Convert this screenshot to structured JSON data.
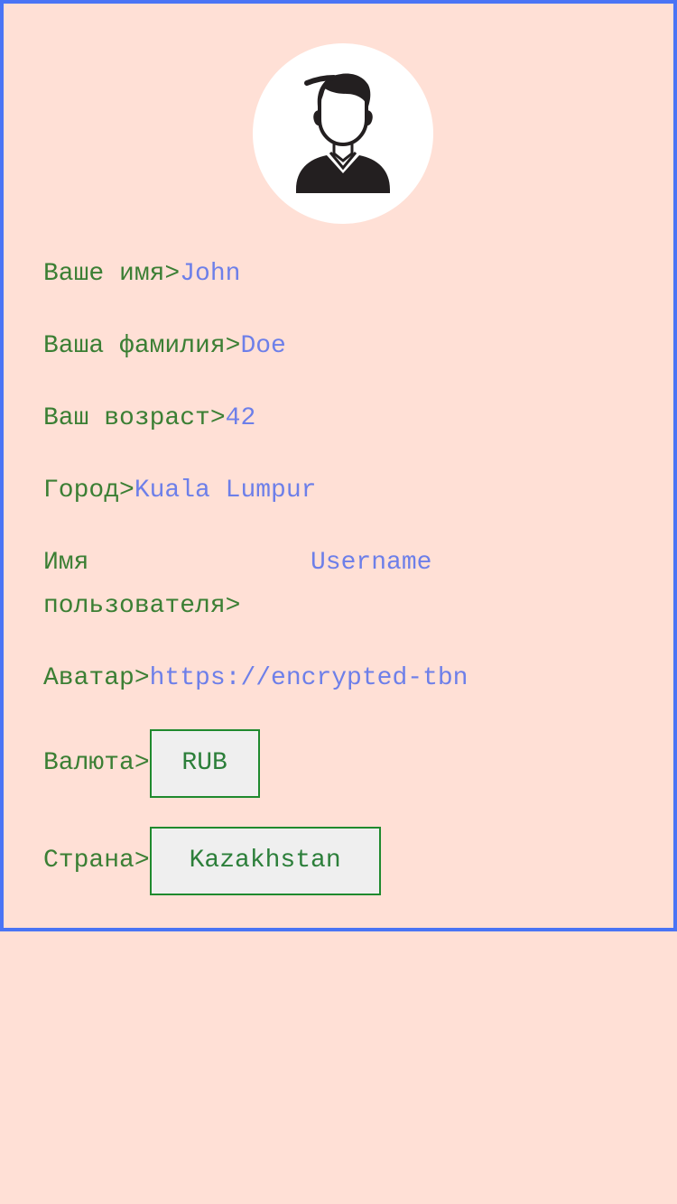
{
  "profile": {
    "avatar_icon": "user-silhouette-icon",
    "fields": {
      "name_label": "Ваше имя>",
      "name_value": "John",
      "surname_label": "Ваша фамилия>",
      "surname_value": "Doe",
      "age_label": "Ваш возраст>",
      "age_value": "42",
      "city_label": "Город>",
      "city_value": "Kuala Lumpur",
      "username_label_line1": "Имя",
      "username_label_line2": "пользователя>",
      "username_value": "Username",
      "avatar_label": "Аватар>",
      "avatar_value": "https://encrypted-tbn",
      "currency_label": "Валюта>",
      "currency_value": "RUB",
      "country_label": "Страна>",
      "country_value": "Kazakhstan"
    }
  },
  "colors": {
    "background": "#ffe0d6",
    "border": "#4a74f5",
    "label": "#3b7f34",
    "value": "#6d7fe9",
    "select_border": "#1f8a2e"
  }
}
